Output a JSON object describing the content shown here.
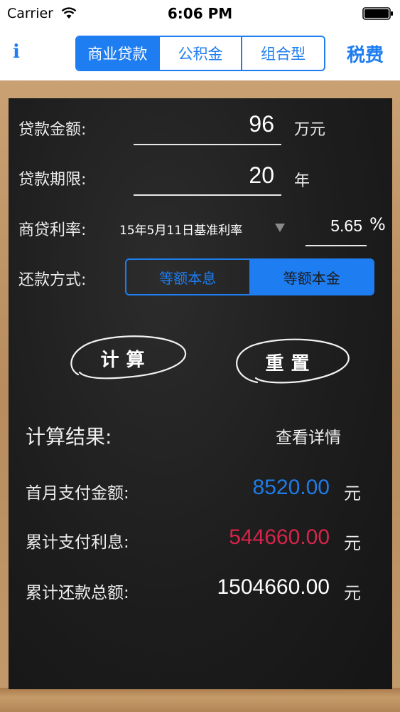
{
  "status_bar": {
    "carrier": "Carrier",
    "time": "6:06 PM",
    "wifi_icon": "wifi-icon",
    "battery_icon": "battery-icon"
  },
  "nav": {
    "info_label": "i",
    "tabs": [
      {
        "label": "商业贷款",
        "active": true
      },
      {
        "label": "公积金",
        "active": false
      },
      {
        "label": "组合型",
        "active": false
      }
    ],
    "tax_label": "税费"
  },
  "form": {
    "amount": {
      "label": "贷款金额:",
      "value": "96",
      "unit": "万元"
    },
    "term": {
      "label": "贷款期限:",
      "value": "20",
      "unit": "年"
    },
    "rate": {
      "label": "商贷利率:",
      "type": "15年5月11日基准利率",
      "dropdown_icon": "triangle-down-icon",
      "value": "5.65",
      "unit": "%"
    },
    "repayment": {
      "label": "还款方式:",
      "options": [
        {
          "label": "等额本息",
          "active": false
        },
        {
          "label": "等额本金",
          "active": true
        }
      ]
    }
  },
  "actions": {
    "calculate_label": "计算",
    "reset_label": "重置"
  },
  "results": {
    "title": "计算结果:",
    "detail_label": "查看详情",
    "rows": [
      {
        "label": "首月支付金额:",
        "value": "8520.00",
        "unit": "元",
        "color": "#1f7be8"
      },
      {
        "label": "累计支付利息:",
        "value": "544660.00",
        "unit": "元",
        "color": "#d8234a"
      },
      {
        "label": "累计还款总额:",
        "value": "1504660.00",
        "unit": "元",
        "color": "#ffffff"
      }
    ]
  },
  "colors": {
    "accent": "#1e7df0",
    "board": "#1d1d1d",
    "frame": "#c29a6b"
  }
}
